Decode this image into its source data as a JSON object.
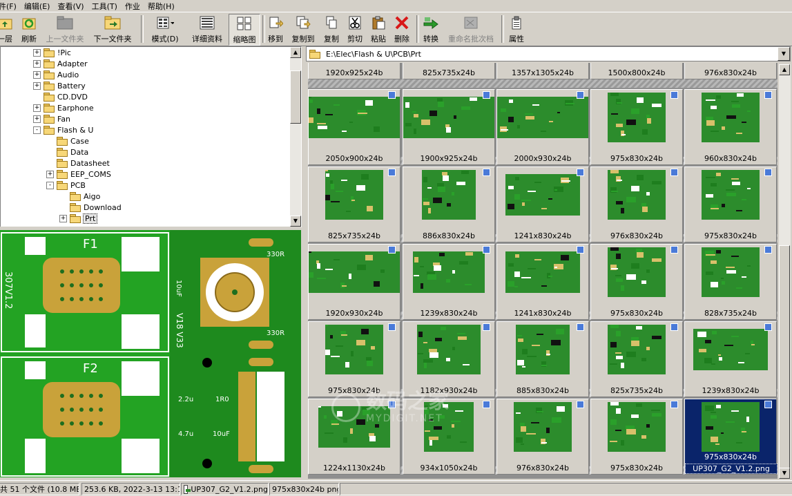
{
  "menu": [
    "件(F)",
    "编辑(E)",
    "查看(V)",
    "工具(T)",
    "作业",
    "帮助(H)"
  ],
  "toolbar": {
    "up": "一层",
    "refresh": "刷新",
    "prev_folder": "上一文件夹",
    "next_folder": "下一文件夹",
    "mode": "模式(D)",
    "details": "详细资料",
    "thumbnails": "缩略图",
    "move_to": "移到",
    "copy_to": "复制到",
    "copy": "复制",
    "cut": "剪切",
    "paste": "粘贴",
    "delete": "删除",
    "convert": "转换",
    "batch_rename": "重命名批次档",
    "properties": "属性"
  },
  "tree": [
    {
      "label": "!Pic",
      "expander": "+",
      "level": 0
    },
    {
      "label": "Adapter",
      "expander": "+",
      "level": 0
    },
    {
      "label": "Audio",
      "expander": "+",
      "level": 0
    },
    {
      "label": "Battery",
      "expander": "+",
      "level": 0
    },
    {
      "label": "CD.DVD",
      "expander": "",
      "level": 0
    },
    {
      "label": "Earphone",
      "expander": "+",
      "level": 0
    },
    {
      "label": "Fan",
      "expander": "+",
      "level": 0
    },
    {
      "label": "Flash & U",
      "expander": "-",
      "level": 0
    },
    {
      "label": "Case",
      "expander": "",
      "level": 1
    },
    {
      "label": "Data",
      "expander": "",
      "level": 1
    },
    {
      "label": "Datasheet",
      "expander": "",
      "level": 1
    },
    {
      "label": "EEP_COMS",
      "expander": "+",
      "level": 1
    },
    {
      "label": "PCB",
      "expander": "-",
      "level": 1
    },
    {
      "label": "Aigo",
      "expander": "",
      "level": 2
    },
    {
      "label": "Download",
      "expander": "",
      "level": 2
    },
    {
      "label": "Prt",
      "expander": "+",
      "level": 2,
      "selected": true
    }
  ],
  "path": "E:\\Elec\\Flash & U\\PCB\\Prt",
  "preview_text": {
    "f1": "F1",
    "f2": "F2",
    "side_left": "307V1.2",
    "side_mid": "V18  V33",
    "r1": "330R",
    "r2": "330R",
    "c1": "10uF",
    "c2": "2.2u",
    "r3": "1R0",
    "c3": "4.7u",
    "c4": "10uF"
  },
  "partial_row": [
    "1920x925x24b",
    "825x735x24b",
    "1357x1305x24b",
    "1500x800x24b",
    "976x830x24b"
  ],
  "rows": [
    [
      "2050x900x24b",
      "1900x925x24b",
      "2000x930x24b",
      "975x830x24b",
      "960x830x24b"
    ],
    [
      "825x735x24b",
      "886x830x24b",
      "1241x830x24b",
      "976x830x24b",
      "975x830x24b"
    ],
    [
      "1920x930x24b",
      "1239x830x24b",
      "1241x830x24b",
      "975x830x24b",
      "828x735x24b"
    ],
    [
      "975x830x24b",
      "1182x930x24b",
      "885x830x24b",
      "825x735x24b",
      "1239x830x24b"
    ],
    [
      "1224x1130x24b",
      "934x1050x24b",
      "976x830x24b",
      "975x830x24b",
      "975x830x24b"
    ]
  ],
  "selected_file": "UP307_G2_V1.2.png",
  "watermark": {
    "cn": "数码之家",
    "en": "MYDIGIT.NET"
  },
  "status": {
    "count": "共 51 个文件 (10.8 MB)",
    "fileinfo": "253.6 KB, 2022-3-13 13:12",
    "filename": "UP307_G2_V1.2.png",
    "dims": "975x830x24b png"
  }
}
